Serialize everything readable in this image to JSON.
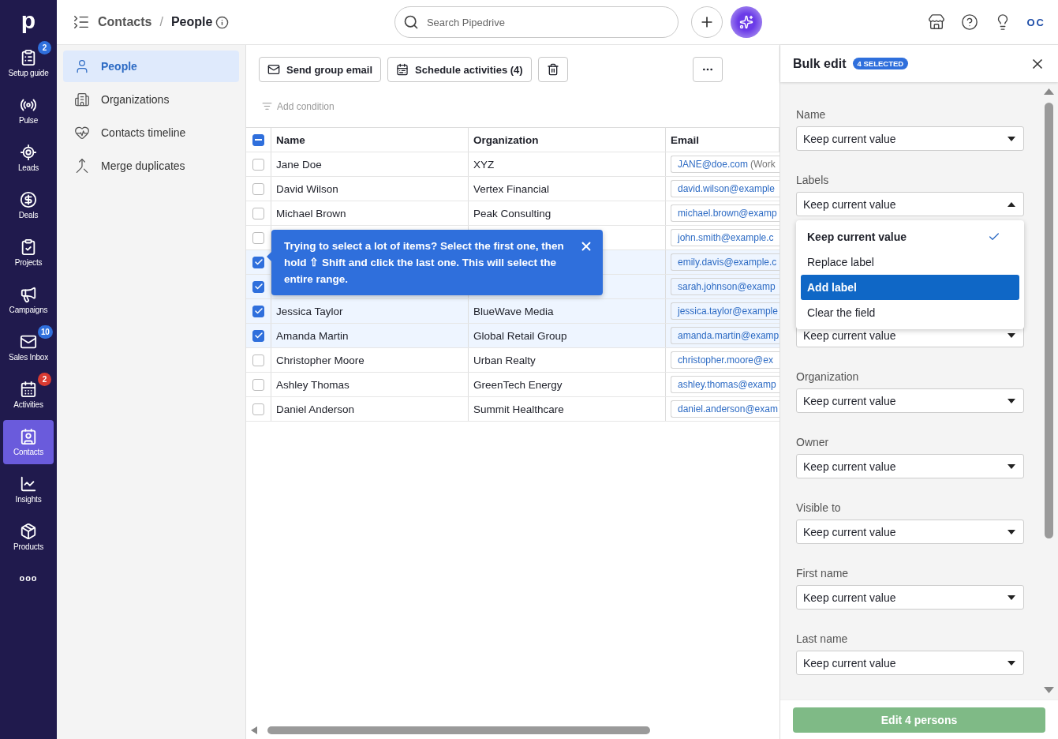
{
  "nav": {
    "logo": "p",
    "items": [
      {
        "kind": "guide",
        "label": "Setup guide",
        "selected": false,
        "badge": {
          "text": "2",
          "color": "#2f6fdc"
        }
      },
      {
        "kind": "pulse",
        "label": "Pulse",
        "selected": false
      },
      {
        "kind": "leads",
        "label": "Leads",
        "selected": false
      },
      {
        "kind": "deals",
        "label": "Deals",
        "selected": false
      },
      {
        "kind": "projects",
        "label": "Projects",
        "selected": false
      },
      {
        "kind": "campaigns",
        "label": "Campaigns",
        "selected": false
      },
      {
        "kind": "inbox",
        "label": "Sales Inbox",
        "selected": false,
        "badge": {
          "text": "10",
          "color": "#2f6fdc"
        }
      },
      {
        "kind": "activities",
        "label": "Activities",
        "selected": false,
        "badge": {
          "text": "2",
          "color": "#d93a32"
        }
      },
      {
        "kind": "contacts",
        "label": "Contacts",
        "selected": true
      },
      {
        "kind": "insights",
        "label": "Insights",
        "selected": false
      },
      {
        "kind": "products",
        "label": "Products",
        "selected": false
      }
    ],
    "more": "ooo"
  },
  "header": {
    "breadcrumb": [
      "Contacts",
      "People"
    ],
    "separator": "/",
    "search": {
      "placeholder": "Search Pipedrive"
    },
    "avatar": "OC"
  },
  "sidebar": {
    "items": [
      {
        "kind": "person",
        "label": "People",
        "selected": true
      },
      {
        "kind": "building",
        "label": "Organizations",
        "selected": false
      },
      {
        "kind": "heart",
        "label": "Contacts timeline",
        "selected": false
      },
      {
        "kind": "merge",
        "label": "Merge duplicates",
        "selected": false
      }
    ]
  },
  "toolbar": {
    "buttons": [
      {
        "kind": "mail",
        "label": "Send group email"
      },
      {
        "kind": "calendar",
        "label": "Schedule activities (4)"
      },
      {
        "kind": "trash"
      }
    ],
    "add_condition": "Add condition"
  },
  "table": {
    "select_all": {
      "checked": true,
      "indeterminate": true
    },
    "columns": [
      "Name",
      "Organization",
      "Email"
    ],
    "rows": [
      {
        "checked": false,
        "name": "Jane Doe",
        "organization": "XYZ",
        "email": "JANE@doe.com",
        "email_note": "(Work"
      },
      {
        "checked": false,
        "name": "David Wilson",
        "organization": "Vertex Financial",
        "email": "david.wilson@example"
      },
      {
        "checked": false,
        "name": "Michael Brown",
        "organization": "Peak Consulting",
        "email": "michael.brown@examp"
      },
      {
        "checked": false,
        "email": "john.smith@example.c"
      },
      {
        "checked": true,
        "email": "emily.davis@example.c"
      },
      {
        "checked": true,
        "email": "sarah.johnson@examp"
      },
      {
        "checked": true,
        "name": "Jessica Taylor",
        "organization": "BlueWave Media",
        "email": "jessica.taylor@example"
      },
      {
        "checked": true,
        "name": "Amanda Martin",
        "organization": "Global Retail Group",
        "email": "amanda.martin@examp"
      },
      {
        "checked": false,
        "name": "Christopher Moore",
        "organization": "Urban Realty",
        "email": "christopher.moore@ex"
      },
      {
        "checked": false,
        "name": "Ashley Thomas",
        "organization": "GreenTech Energy",
        "email": "ashley.thomas@examp"
      },
      {
        "checked": false,
        "name": "Daniel Anderson",
        "organization": "Summit Healthcare",
        "email": "daniel.anderson@exam"
      }
    ]
  },
  "tooltip": {
    "text": "Trying to select a lot of items? Select the first one, then hold ⇧ Shift and click the last one. This will select the entire range."
  },
  "bulk_edit": {
    "title": "Bulk edit",
    "badge": "4 SELECTED",
    "fields": [
      {
        "label": "Name",
        "value": "Keep current value",
        "expanded": false
      },
      {
        "label": "Labels",
        "value": "Keep current value",
        "expanded": true,
        "options": [
          {
            "label": "Keep current value",
            "selected": true,
            "highlighted": false
          },
          {
            "label": "Replace label",
            "selected": false,
            "highlighted": false
          },
          {
            "label": "Add label",
            "selected": false,
            "highlighted": true
          },
          {
            "label": "Clear the field",
            "selected": false,
            "highlighted": false
          }
        ]
      },
      {
        "value": "Keep current value",
        "expanded": false
      },
      {
        "label": "Organization",
        "value": "Keep current value",
        "expanded": false
      },
      {
        "label": "Owner",
        "value": "Keep current value",
        "expanded": false
      },
      {
        "label": "Visible to",
        "value": "Keep current value",
        "expanded": false
      },
      {
        "label": "First name",
        "value": "Keep current value",
        "expanded": false
      },
      {
        "label": "Last name",
        "value": "Keep current value",
        "expanded": false
      }
    ],
    "submit": "Edit 4 persons"
  }
}
